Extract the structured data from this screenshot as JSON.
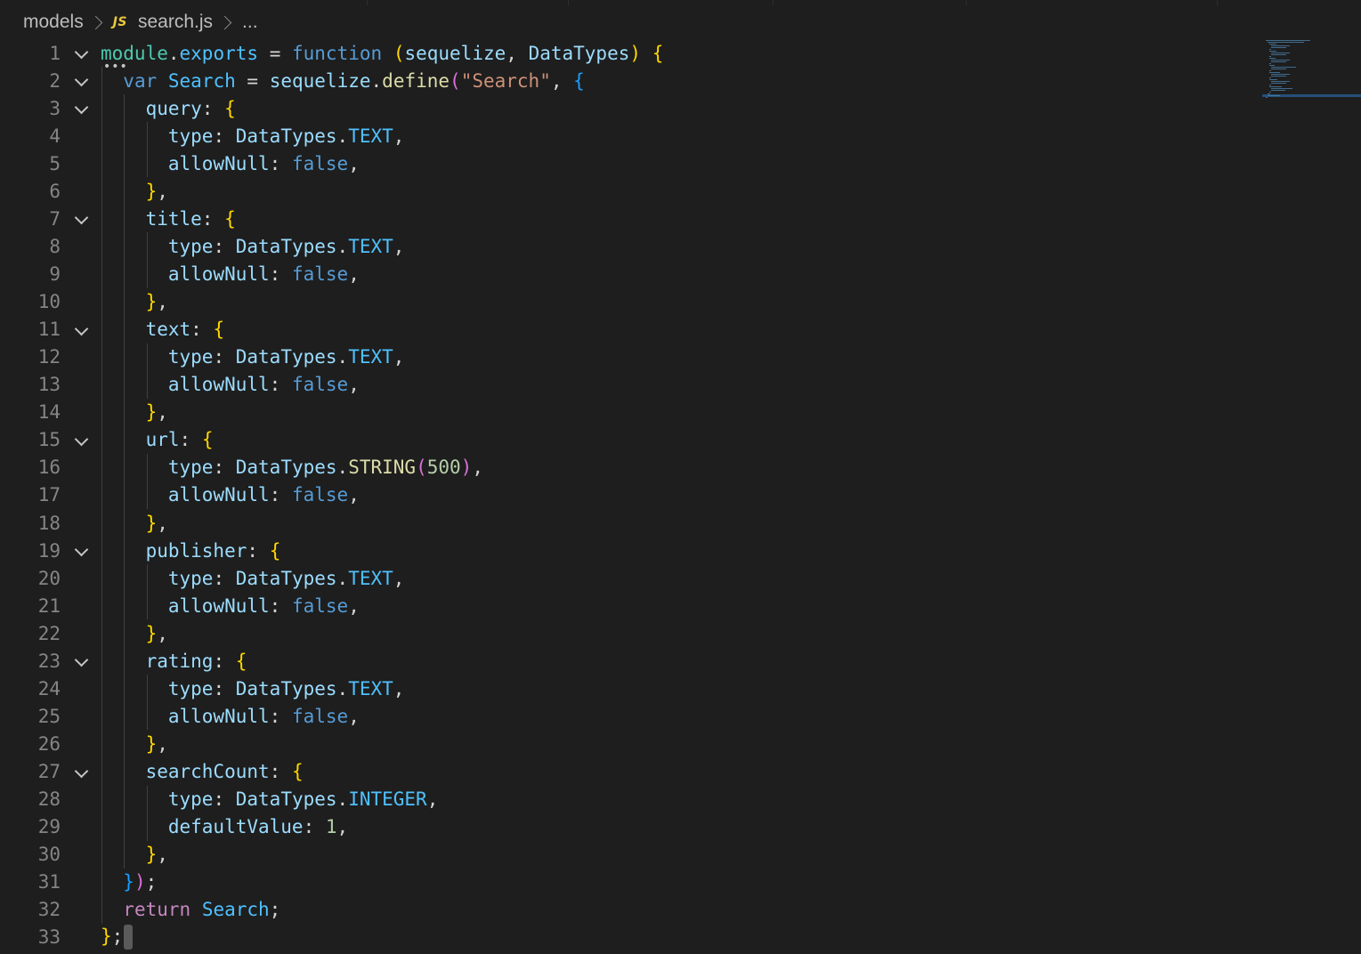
{
  "breadcrumb": {
    "folder": "models",
    "file_icon": "JS",
    "file": "search.js",
    "ellipsis": "..."
  },
  "editor": {
    "language": "javascript",
    "lines": [
      "module.exports = function (sequelize, DataTypes) {",
      "  var Search = sequelize.define(\"Search\", {",
      "    query: {",
      "      type: DataTypes.TEXT,",
      "      allowNull: false,",
      "    },",
      "    title: {",
      "      type: DataTypes.TEXT,",
      "      allowNull: false,",
      "    },",
      "    text: {",
      "      type: DataTypes.TEXT,",
      "      allowNull: false,",
      "    },",
      "    url: {",
      "      type: DataTypes.STRING(500),",
      "      allowNull: false,",
      "    },",
      "    publisher: {",
      "      type: DataTypes.TEXT,",
      "      allowNull: false,",
      "    },",
      "    rating: {",
      "      type: DataTypes.TEXT,",
      "      allowNull: false,",
      "    },",
      "    searchCount: {",
      "      type: DataTypes.INTEGER,",
      "      defaultValue: 1,",
      "    },",
      "  });",
      "  return Search;",
      "};"
    ],
    "fold_lines": [
      1,
      2,
      3,
      7,
      11,
      15,
      19,
      23,
      27
    ]
  },
  "colors": {
    "background": "#1e1e1e",
    "line_number": "#858585",
    "bracket_gold": "#ffd700",
    "bracket_purple": "#da70d6",
    "bracket_blue": "#179fff",
    "keyword": "#569cd6",
    "property": "#9cdcfe",
    "type_name": "#4ec9b0",
    "function": "#dcdcaa",
    "string": "#ce9178",
    "constant": "#4fc1ff",
    "number": "#b5cea8",
    "control": "#c586c0"
  }
}
